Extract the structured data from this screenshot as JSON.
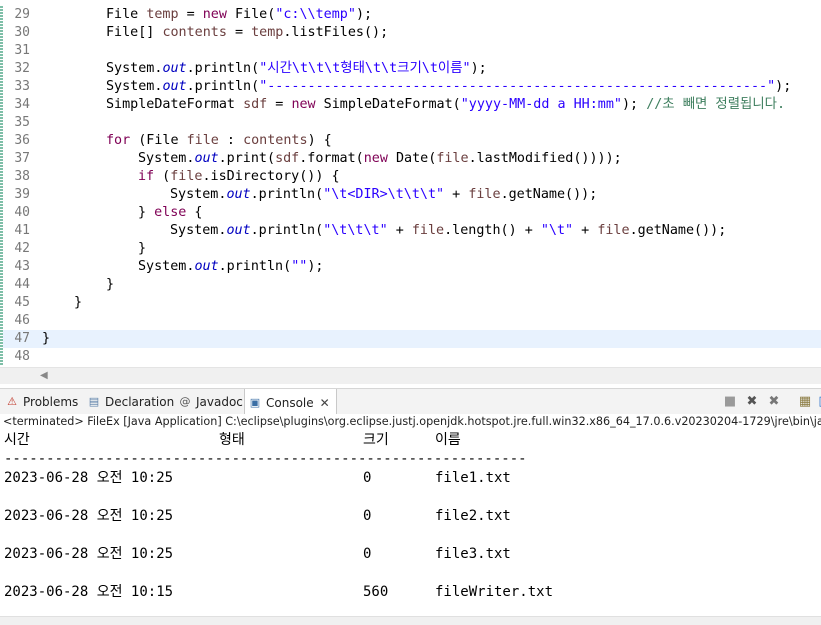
{
  "editor": {
    "lines": [
      {
        "num": "29",
        "indent": 2,
        "segs": [
          [
            "p",
            "File "
          ],
          [
            "var",
            "temp"
          ],
          [
            "p",
            " = "
          ],
          [
            "kw",
            "new"
          ],
          [
            "p",
            " File("
          ],
          [
            "str",
            "\"c:\\\\temp\""
          ],
          [
            "p",
            ");"
          ]
        ]
      },
      {
        "num": "30",
        "indent": 2,
        "segs": [
          [
            "p",
            "File[] "
          ],
          [
            "var",
            "contents"
          ],
          [
            "p",
            " = "
          ],
          [
            "var",
            "temp"
          ],
          [
            "p",
            ".listFiles();"
          ]
        ]
      },
      {
        "num": "31",
        "indent": 0,
        "segs": []
      },
      {
        "num": "32",
        "indent": 2,
        "segs": [
          [
            "p",
            "System."
          ],
          [
            "fld",
            "out"
          ],
          [
            "p",
            ".println("
          ],
          [
            "str",
            "\"시간\\t\\t\\t형태\\t\\t크기\\t이름\""
          ],
          [
            "p",
            ");"
          ]
        ]
      },
      {
        "num": "33",
        "indent": 2,
        "segs": [
          [
            "p",
            "System."
          ],
          [
            "fld",
            "out"
          ],
          [
            "p",
            ".println("
          ],
          [
            "str",
            "\"--------------------------------------------------------------\""
          ],
          [
            "p",
            ");"
          ]
        ]
      },
      {
        "num": "34",
        "indent": 2,
        "segs": [
          [
            "p",
            "SimpleDateFormat "
          ],
          [
            "var",
            "sdf"
          ],
          [
            "p",
            " = "
          ],
          [
            "kw",
            "new"
          ],
          [
            "p",
            " SimpleDateFormat("
          ],
          [
            "str",
            "\"yyyy-MM-dd a HH:mm\""
          ],
          [
            "p",
            "); "
          ],
          [
            "cm",
            "//초 빼면 정렬됩니다."
          ]
        ]
      },
      {
        "num": "35",
        "indent": 0,
        "segs": []
      },
      {
        "num": "36",
        "indent": 2,
        "segs": [
          [
            "kw",
            "for"
          ],
          [
            "p",
            " (File "
          ],
          [
            "var",
            "file"
          ],
          [
            "p",
            " : "
          ],
          [
            "var",
            "contents"
          ],
          [
            "p",
            ") {"
          ]
        ]
      },
      {
        "num": "37",
        "indent": 3,
        "segs": [
          [
            "p",
            "System."
          ],
          [
            "fld",
            "out"
          ],
          [
            "p",
            ".print("
          ],
          [
            "var",
            "sdf"
          ],
          [
            "p",
            ".format("
          ],
          [
            "kw",
            "new"
          ],
          [
            "p",
            " Date("
          ],
          [
            "var",
            "file"
          ],
          [
            "p",
            ".lastModified())));"
          ]
        ]
      },
      {
        "num": "38",
        "indent": 3,
        "segs": [
          [
            "kw",
            "if"
          ],
          [
            "p",
            " ("
          ],
          [
            "var",
            "file"
          ],
          [
            "p",
            ".isDirectory()) {"
          ]
        ]
      },
      {
        "num": "39",
        "indent": 4,
        "segs": [
          [
            "p",
            "System."
          ],
          [
            "fld",
            "out"
          ],
          [
            "p",
            ".println("
          ],
          [
            "str",
            "\"\\t<DIR>\\t\\t\\t\""
          ],
          [
            "p",
            " + "
          ],
          [
            "var",
            "file"
          ],
          [
            "p",
            ".getName());"
          ]
        ]
      },
      {
        "num": "40",
        "indent": 3,
        "segs": [
          [
            "p",
            "} "
          ],
          [
            "kw",
            "else"
          ],
          [
            "p",
            " {"
          ]
        ]
      },
      {
        "num": "41",
        "indent": 4,
        "segs": [
          [
            "p",
            "System."
          ],
          [
            "fld",
            "out"
          ],
          [
            "p",
            ".println("
          ],
          [
            "str",
            "\"\\t\\t\\t\""
          ],
          [
            "p",
            " + "
          ],
          [
            "var",
            "file"
          ],
          [
            "p",
            ".length() + "
          ],
          [
            "str",
            "\"\\t\""
          ],
          [
            "p",
            " + "
          ],
          [
            "var",
            "file"
          ],
          [
            "p",
            ".getName());"
          ]
        ]
      },
      {
        "num": "42",
        "indent": 3,
        "segs": [
          [
            "p",
            "}"
          ]
        ]
      },
      {
        "num": "43",
        "indent": 3,
        "segs": [
          [
            "p",
            "System."
          ],
          [
            "fld",
            "out"
          ],
          [
            "p",
            ".println("
          ],
          [
            "str",
            "\"\""
          ],
          [
            "p",
            ");"
          ]
        ]
      },
      {
        "num": "44",
        "indent": 2,
        "segs": [
          [
            "p",
            "}"
          ]
        ]
      },
      {
        "num": "45",
        "indent": 1,
        "segs": [
          [
            "p",
            "}"
          ]
        ]
      },
      {
        "num": "46",
        "indent": 0,
        "segs": []
      },
      {
        "num": "47",
        "indent": 0,
        "current": true,
        "segs": [
          [
            "p",
            "}"
          ]
        ]
      },
      {
        "num": "48",
        "indent": 0,
        "segs": []
      }
    ]
  },
  "tabs": [
    {
      "id": "problems",
      "label": "Problems",
      "icon": "problems-icon",
      "glyph": "⚠",
      "color": "#c0392b"
    },
    {
      "id": "declaration",
      "label": "Declaration",
      "icon": "declaration-icon",
      "glyph": "▤",
      "color": "#5a7fa8"
    },
    {
      "id": "javadoc",
      "label": "Javadoc",
      "icon": "javadoc-icon",
      "glyph": "@",
      "color": "#555555"
    },
    {
      "id": "console",
      "label": "Console",
      "icon": "console-icon",
      "glyph": "▣",
      "color": "#3a6ea5",
      "active": true,
      "close": "✕"
    }
  ],
  "toolbar": [
    {
      "name": "terminate-icon",
      "glyph": "■",
      "color": "#9a9a9a"
    },
    {
      "name": "remove-launch-icon",
      "glyph": "✖",
      "color": "#555555"
    },
    {
      "name": "remove-all-terminated-icon",
      "glyph": "✖",
      "color": "#777777"
    },
    {
      "name": "scroll-lock-icon",
      "glyph": "▦",
      "color": "#8a7a40"
    },
    {
      "name": "pin-console-icon",
      "glyph": "▯",
      "color": "#2a6fc9"
    }
  ],
  "console": {
    "header": "<terminated> FileEx [Java Application] C:\\eclipse\\plugins\\org.eclipse.justj.openjdk.hotspot.jre.full.win32.x86_64_17.0.6.v20230204-1729\\jre\\bin\\javaw.exe",
    "column_headers": {
      "time": "시간",
      "type": "형태",
      "size": "크기",
      "name": "이름"
    },
    "divider": "--------------------------------------------------------------",
    "rows": [
      {
        "time": "2023-06-28 오전 10:25",
        "size": "0",
        "name": "file1.txt"
      },
      {
        "time": "2023-06-28 오전 10:25",
        "size": "0",
        "name": "file2.txt"
      },
      {
        "time": "2023-06-28 오전 10:25",
        "size": "0",
        "name": "file3.txt"
      },
      {
        "time": "2023-06-28 오전 10:15",
        "size": "560",
        "name": "fileWriter.txt"
      }
    ]
  }
}
